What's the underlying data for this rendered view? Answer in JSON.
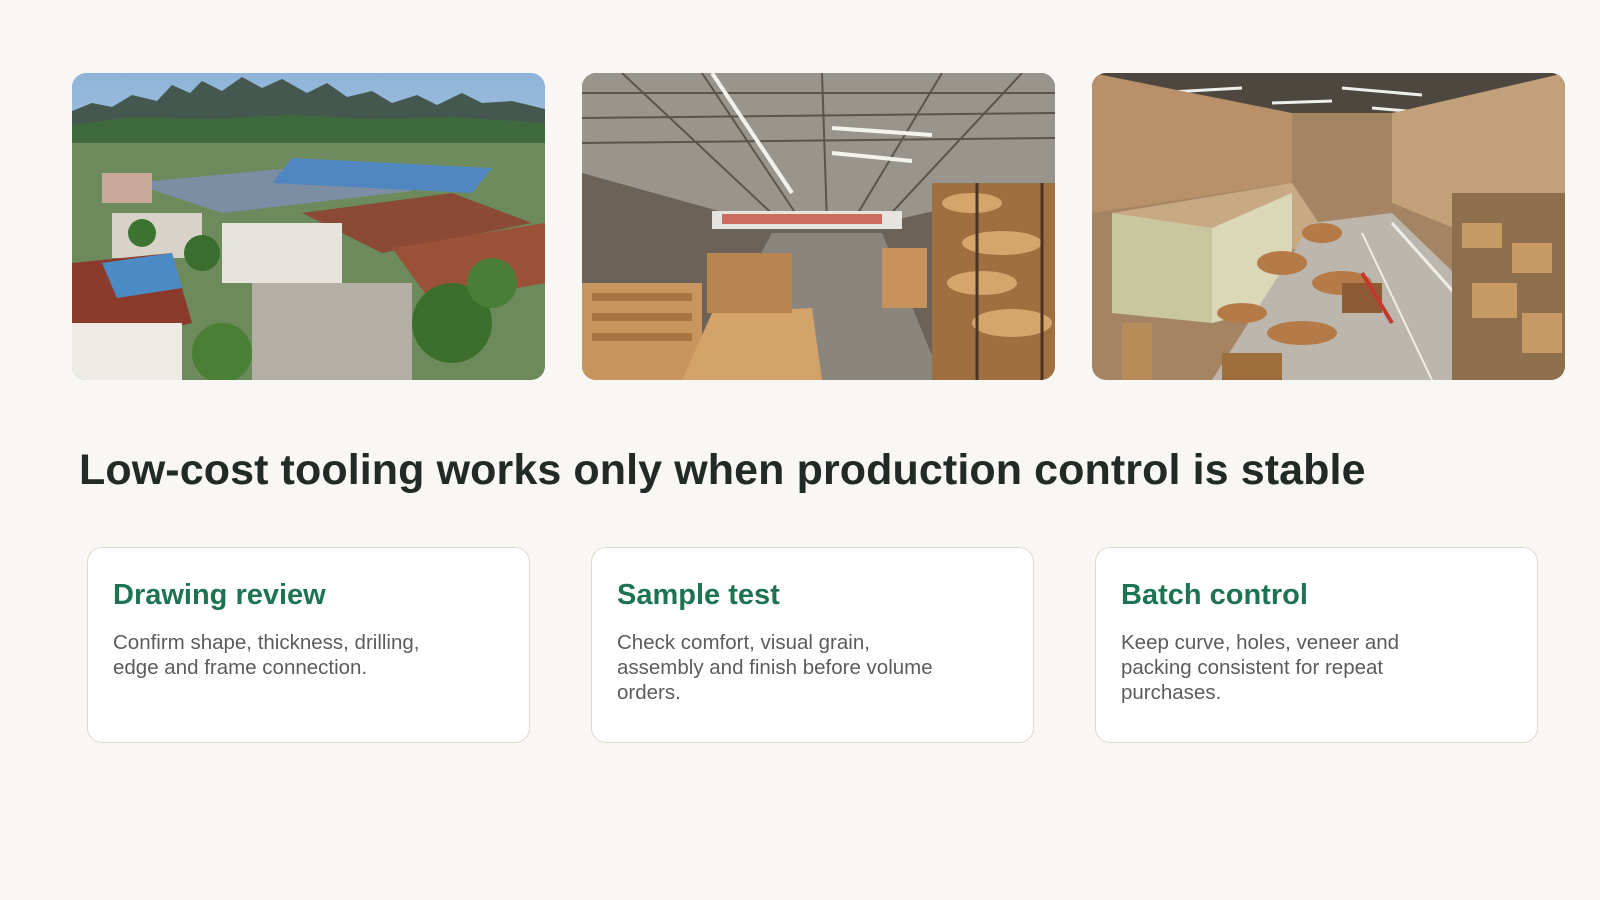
{
  "photos": [
    {
      "name": "factory-aerial-photo",
      "alt": "Aerial view of factory campus with karst mountains"
    },
    {
      "name": "warehouse-interior-photo",
      "alt": "Large warehouse with stacks of bent plywood parts"
    },
    {
      "name": "workshop-floor-photo",
      "alt": "Workshop floor with curved plywood shells and shelving"
    }
  ],
  "headline": "Low-cost tooling works only when production control is stable",
  "cards": [
    {
      "title": "Drawing review",
      "text": "Confirm shape, thickness, drilling, edge and frame connection."
    },
    {
      "title": "Sample test",
      "text": "Check comfort, visual grain, assembly and finish before volume orders."
    },
    {
      "title": "Batch control",
      "text": "Keep curve, holes, veneer and packing consistent for repeat purchases."
    }
  ],
  "colors": {
    "background": "#f8f7f3",
    "headline": "#222a27",
    "accent_green": "#1e7352",
    "body_text": "#5b5d5a",
    "card_border": "#ddd7cc"
  }
}
